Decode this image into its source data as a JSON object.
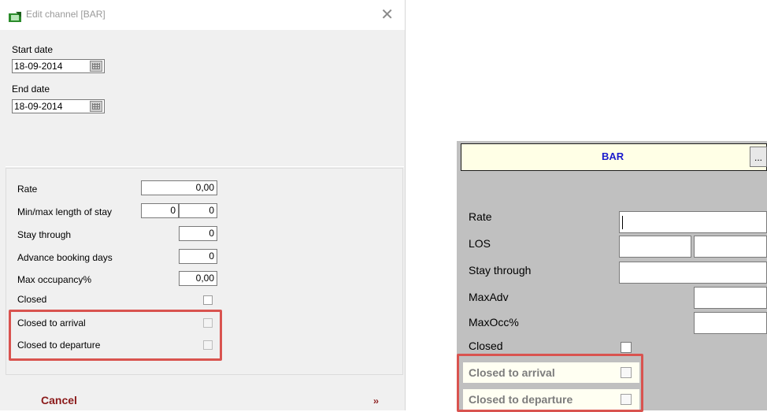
{
  "dialog": {
    "title": "Edit channel [BAR]",
    "start_date_label": "Start date",
    "start_date_value": "18-09-2014",
    "end_date_label": "End date",
    "end_date_value": "18-09-2014",
    "fields": {
      "rate_label": "Rate",
      "rate_value": "0,00",
      "los_label": "Min/max length of stay",
      "los_min": "0",
      "los_max": "0",
      "stay_through_label": "Stay through",
      "stay_through_value": "0",
      "advance_label": "Advance booking days",
      "advance_value": "0",
      "max_occ_label": "Max occupancy%",
      "max_occ_value": "0,00",
      "closed_label": "Closed",
      "cta_label": "Closed to arrival",
      "ctd_label": "Closed to departure"
    },
    "cancel_label": "Cancel",
    "next_label": "››"
  },
  "right": {
    "header_title": "BAR",
    "ellipsis_label": "...",
    "rate_label": "Rate",
    "los_label": "LOS",
    "stay_through_label": "Stay through",
    "max_adv_label": "MaxAdv",
    "max_occ_label": "MaxOcc%",
    "closed_label": "Closed",
    "cta_label": "Closed to arrival",
    "ctd_label": "Closed to departure"
  },
  "colors": {
    "highlight": "#d9534f",
    "cancel_text": "#8b1a1a",
    "header_title": "#1a1acc",
    "header_bg": "#ffffe6"
  },
  "icons": [
    "app-icon",
    "close-icon",
    "calendar-icon"
  ]
}
